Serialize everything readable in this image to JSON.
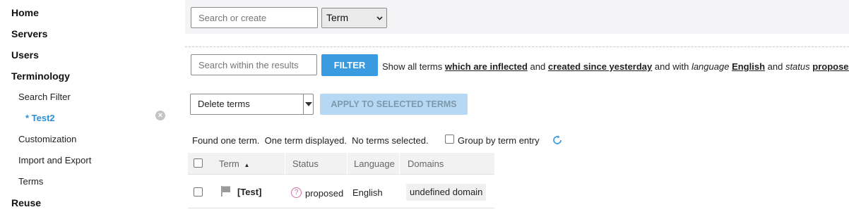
{
  "sidebar": {
    "items": [
      {
        "label": "Home"
      },
      {
        "label": "Servers"
      },
      {
        "label": "Users"
      },
      {
        "label": "Terminology"
      },
      {
        "label": "Search Filter"
      },
      {
        "label": "* Test2"
      },
      {
        "label": "Customization"
      },
      {
        "label": "Import and Export"
      },
      {
        "label": "Terms"
      },
      {
        "label": "Reuse"
      }
    ],
    "clear_glyph": "×"
  },
  "topbar": {
    "search_placeholder": "Search or create",
    "type_select_value": "Term"
  },
  "filter": {
    "search_placeholder": "Search within the results",
    "button_label": "FILTER",
    "desc": {
      "t1": "Show all terms ",
      "l1": "which are inflected",
      "t2": " and ",
      "l2": "created since yesterday",
      "t3": " and with ",
      "i1": "language",
      "t4": " ",
      "l3": "English",
      "t5": " and ",
      "i2": "status",
      "t6": " ",
      "l4": "proposed"
    }
  },
  "actions": {
    "select_value": "Delete terms",
    "apply_label": "APPLY TO SELECTED TERMS"
  },
  "status_line": {
    "text": "Found one term.  One term displayed.  No terms selected.",
    "group_label": "Group by term entry"
  },
  "table": {
    "headers": {
      "term": "Term",
      "sort_glyph": "▲",
      "status": "Status",
      "language": "Language",
      "domains": "Domains"
    },
    "rows": [
      {
        "term": "[Test]",
        "status_glyph": "?",
        "status": "proposed",
        "language": "English",
        "domain": "undefined domain"
      }
    ]
  },
  "colors": {
    "accent": "#3a9be0",
    "active_nav": "#2a8fd6",
    "apply_disabled": "#b6d8f2",
    "proposed_status": "#d06aa8"
  },
  "icons": {
    "clear": "close-circle-icon",
    "refresh": "refresh-icon",
    "flag": "flag-icon",
    "status": "question-circle-icon"
  }
}
